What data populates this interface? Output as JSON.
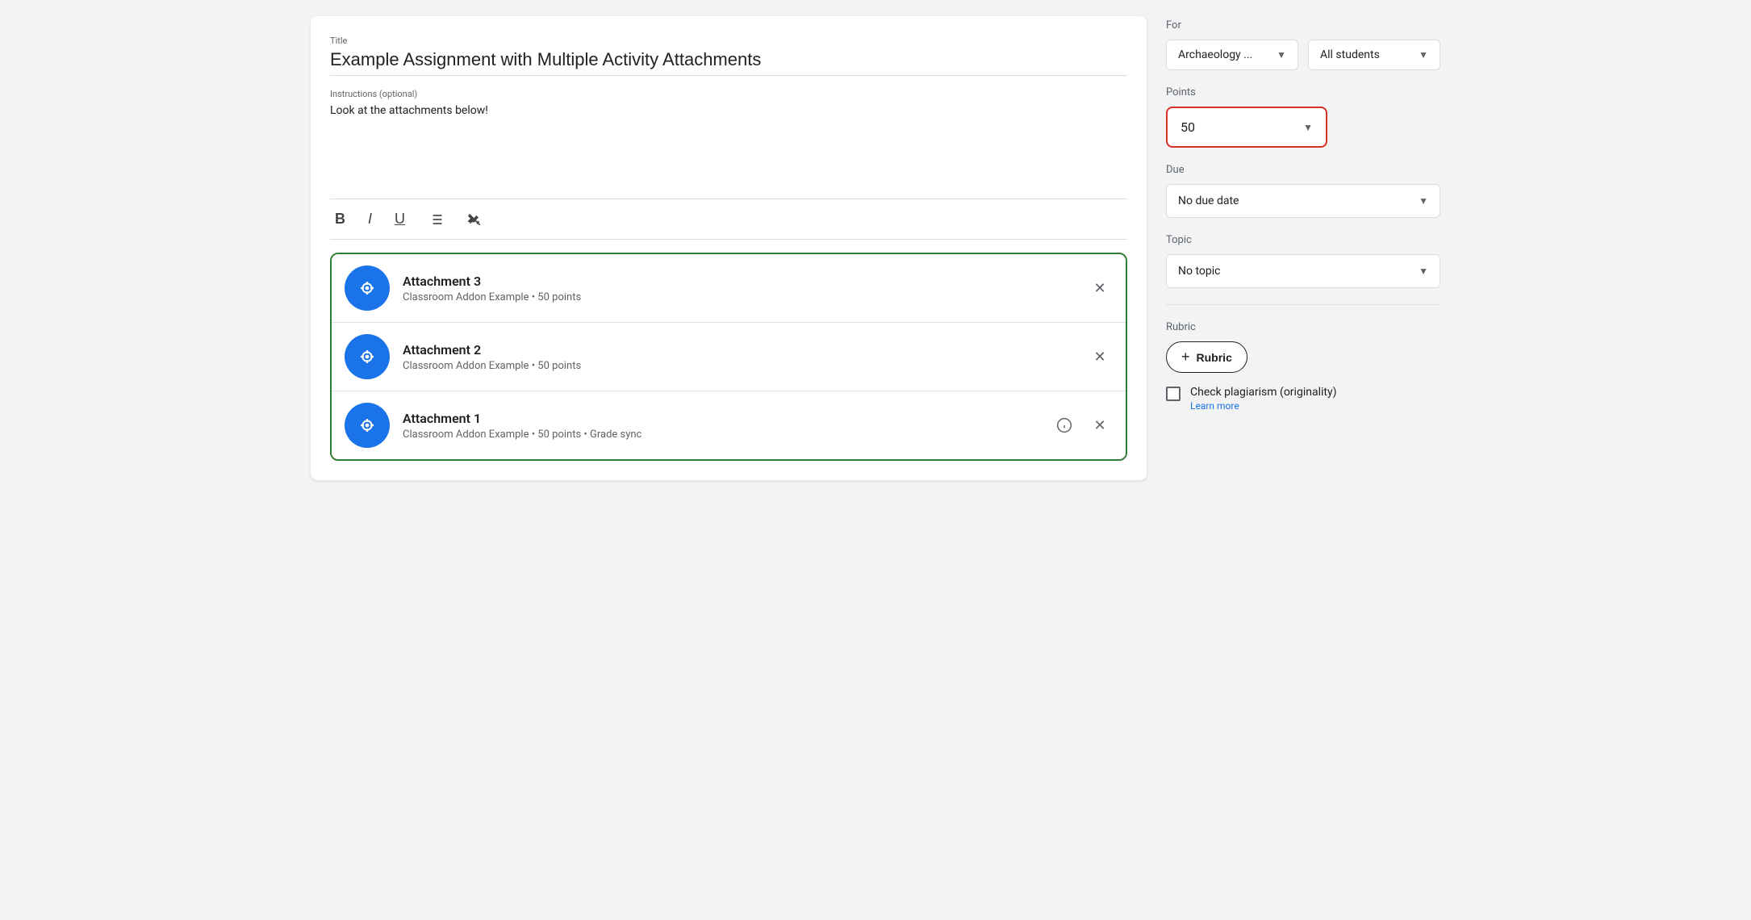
{
  "left": {
    "title_label": "Title",
    "title_value": "Example Assignment with Multiple Activity Attachments",
    "instructions_label": "Instructions (optional)",
    "instructions_value": "Look at the attachments below!",
    "toolbar": {
      "bold_label": "B",
      "italic_label": "I",
      "underline_label": "U",
      "list_label": "≡",
      "clear_label": "✕"
    },
    "attachments": [
      {
        "id": "attachment-3",
        "title": "Attachment 3",
        "subtitle": "Classroom Addon Example • 50 points",
        "has_info": false
      },
      {
        "id": "attachment-2",
        "title": "Attachment 2",
        "subtitle": "Classroom Addon Example • 50 points",
        "has_info": false
      },
      {
        "id": "attachment-1",
        "title": "Attachment 1",
        "subtitle": "Classroom Addon Example • 50 points • Grade sync",
        "has_info": true
      }
    ]
  },
  "right": {
    "for_label": "For",
    "course_dropdown": "Archaeology ...",
    "students_dropdown": "All students",
    "points_label": "Points",
    "points_value": "50",
    "due_label": "Due",
    "due_value": "No due date",
    "topic_label": "Topic",
    "topic_value": "No topic",
    "rubric_label": "Rubric",
    "rubric_btn_label": "Rubric",
    "rubric_btn_plus": "+",
    "plagiarism_label": "Check plagiarism (originality)",
    "plagiarism_link": "Learn more"
  }
}
